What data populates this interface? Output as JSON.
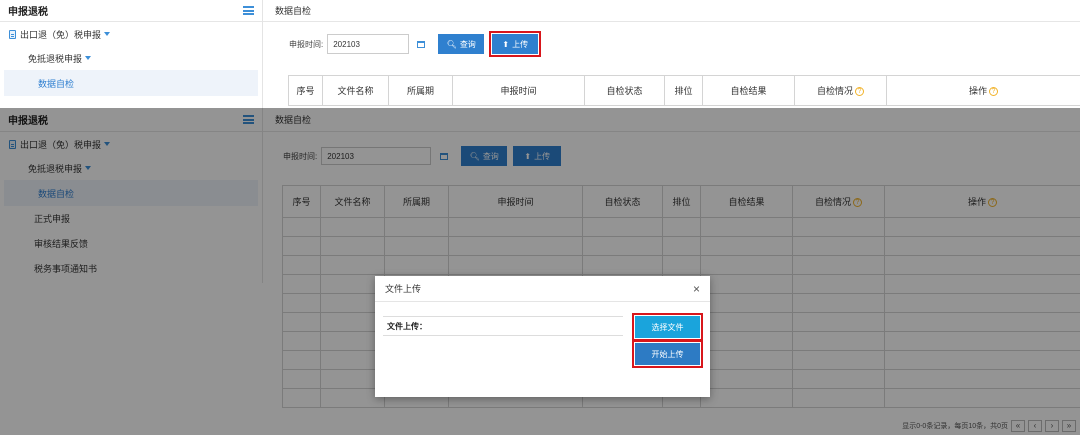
{
  "app": {
    "title": "申报退税"
  },
  "sidebar": {
    "menu_root": "出口退（免）税申报",
    "submenu": "免抵退税申报",
    "items": [
      "数据自检",
      "正式申报",
      "审核结果反馈",
      "税务事项通知书"
    ],
    "active_index": 0
  },
  "page": {
    "breadcrumb": "数据自检"
  },
  "search": {
    "label": "申报时间:",
    "date_value": "202103",
    "query_button": "查询",
    "upload_button": "上传"
  },
  "table": {
    "columns": [
      "序号",
      "文件名称",
      "所属期",
      "申报时间",
      "自检状态",
      "排位",
      "自检结果",
      "自检情况",
      "操作"
    ],
    "help_columns": [
      7,
      8
    ],
    "rows": []
  },
  "pager": {
    "summary": "显示0-0条记录，每页10条，共0页",
    "prev": "‹",
    "first": "«",
    "next": "›",
    "last": "»"
  },
  "dialog": {
    "title": "文件上传",
    "field_label": "文件上传：",
    "choose_button": "选择文件",
    "start_button": "开始上传",
    "close": "×"
  },
  "colors": {
    "primary": "#2f80cf",
    "highlight": "#d8161b",
    "choose_btn": "#1aa4dc",
    "start_btn": "#2d7bc4"
  }
}
